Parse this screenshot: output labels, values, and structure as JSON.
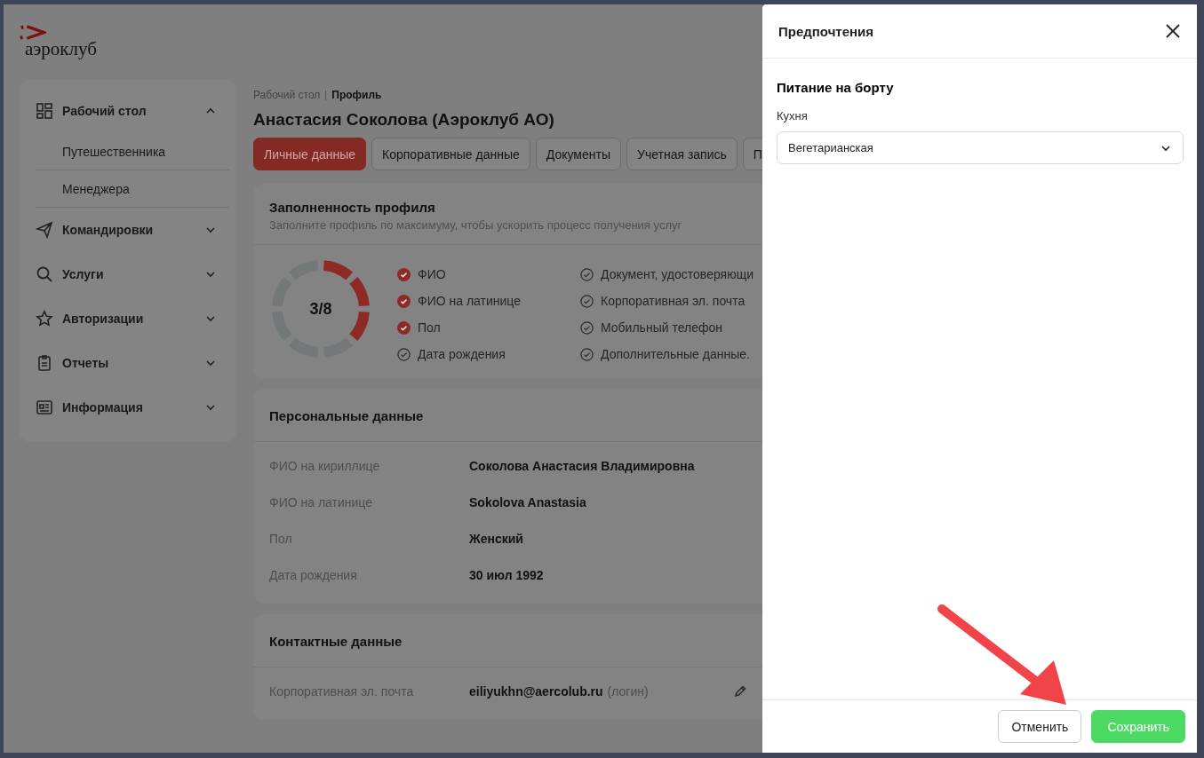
{
  "logo": {
    "text": "аэроклуб"
  },
  "sidebar": {
    "items": [
      {
        "label": "Рабочий стол",
        "expanded": true,
        "children": [
          {
            "label": "Путешественника"
          },
          {
            "label": "Менеджера"
          }
        ]
      },
      {
        "label": "Командировки",
        "expanded": false
      },
      {
        "label": "Услуги",
        "expanded": false
      },
      {
        "label": "Авторизации",
        "expanded": false
      },
      {
        "label": "Отчеты",
        "expanded": false
      },
      {
        "label": "Информация",
        "expanded": false
      }
    ]
  },
  "breadcrumb": [
    "Рабочий стол",
    "Профиль"
  ],
  "page_title": "Анастасия Соколова (Аэроклуб АО)",
  "tabs": [
    {
      "label": "Личные данные",
      "selected": true
    },
    {
      "label": "Корпоративные данные",
      "selected": false
    },
    {
      "label": "Документы",
      "selected": false
    },
    {
      "label": "Учетная запись",
      "selected": false
    },
    {
      "label": "П",
      "selected": false
    }
  ],
  "completion": {
    "title": "Заполненность профиля",
    "subtitle": "Заполните профиль по максимуму, чтобы ускорить процесс получения услуг",
    "segments": [
      {
        "filled": true
      },
      {
        "filled": true
      },
      {
        "filled": true
      },
      {
        "filled": false
      },
      {
        "filled": false
      },
      {
        "filled": false
      },
      {
        "filled": false
      },
      {
        "filled": false
      }
    ],
    "reading": "3/8",
    "items": [
      {
        "label": "ФИО",
        "checked": true
      },
      {
        "label": "ФИО на латинице",
        "checked": true
      },
      {
        "label": "Пол",
        "checked": true
      },
      {
        "label": "Дата рождения",
        "checked": false
      },
      {
        "label": "Документ, удостоверяющи",
        "checked": false
      },
      {
        "label": "Корпоративная эл. почта",
        "checked": false
      },
      {
        "label": "Мобильный телефон",
        "checked": false
      },
      {
        "label": "Дополнительные данные.",
        "checked": false
      }
    ]
  },
  "personal": {
    "title": "Персональные данные",
    "rows": [
      {
        "label": "ФИО на кириллице",
        "value": "Соколова Анастасия Владимировна"
      },
      {
        "label": "ФИО на латинице",
        "value": "Sokolova Anastasia"
      },
      {
        "label": "Пол",
        "value": "Женский"
      },
      {
        "label": "Дата рождения",
        "value": "30 июл 1992"
      }
    ]
  },
  "contacts": {
    "title": "Контактные данные",
    "rows": [
      {
        "label": "Корпоративная эл. почта",
        "value": "eiliyukhn@aercolub.ru",
        "note": "(логин)"
      }
    ]
  },
  "drawer": {
    "title": "Предпочтения",
    "section": "Питание на борту",
    "field": {
      "label": "Кухня",
      "value": "Вегетарианская"
    },
    "buttons": [
      {
        "label": "Отменить",
        "kind": "secondary"
      },
      {
        "label": "Сохранить",
        "kind": "primary"
      }
    ]
  }
}
